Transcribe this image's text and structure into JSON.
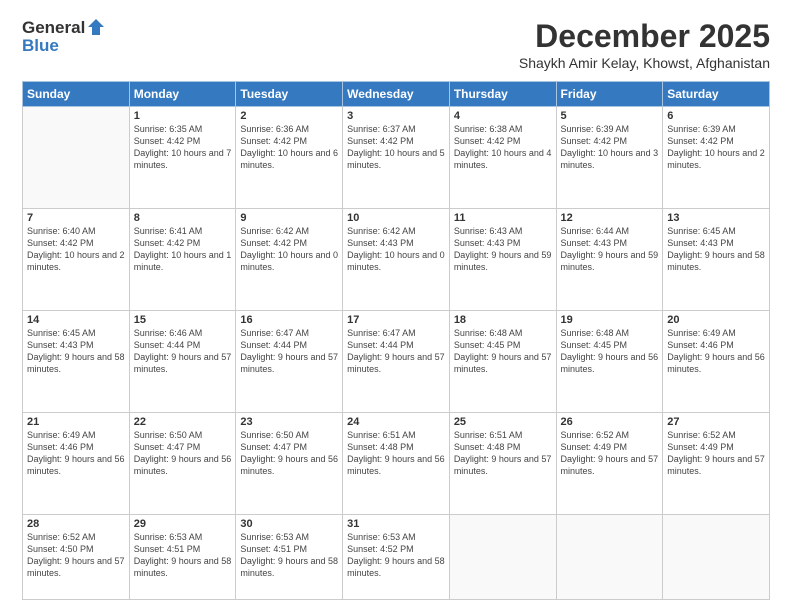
{
  "logo": {
    "line1": "General",
    "line2": "Blue"
  },
  "header": {
    "month": "December 2025",
    "location": "Shaykh Amir Kelay, Khowst, Afghanistan"
  },
  "weekdays": [
    "Sunday",
    "Monday",
    "Tuesday",
    "Wednesday",
    "Thursday",
    "Friday",
    "Saturday"
  ],
  "weeks": [
    [
      {
        "day": null
      },
      {
        "day": "1",
        "sunrise": "6:35 AM",
        "sunset": "4:42 PM",
        "daylight": "10 hours and 7 minutes."
      },
      {
        "day": "2",
        "sunrise": "6:36 AM",
        "sunset": "4:42 PM",
        "daylight": "10 hours and 6 minutes."
      },
      {
        "day": "3",
        "sunrise": "6:37 AM",
        "sunset": "4:42 PM",
        "daylight": "10 hours and 5 minutes."
      },
      {
        "day": "4",
        "sunrise": "6:38 AM",
        "sunset": "4:42 PM",
        "daylight": "10 hours and 4 minutes."
      },
      {
        "day": "5",
        "sunrise": "6:39 AM",
        "sunset": "4:42 PM",
        "daylight": "10 hours and 3 minutes."
      },
      {
        "day": "6",
        "sunrise": "6:39 AM",
        "sunset": "4:42 PM",
        "daylight": "10 hours and 2 minutes."
      }
    ],
    [
      {
        "day": "7",
        "sunrise": "6:40 AM",
        "sunset": "4:42 PM",
        "daylight": "10 hours and 2 minutes."
      },
      {
        "day": "8",
        "sunrise": "6:41 AM",
        "sunset": "4:42 PM",
        "daylight": "10 hours and 1 minute."
      },
      {
        "day": "9",
        "sunrise": "6:42 AM",
        "sunset": "4:42 PM",
        "daylight": "10 hours and 0 minutes."
      },
      {
        "day": "10",
        "sunrise": "6:42 AM",
        "sunset": "4:43 PM",
        "daylight": "10 hours and 0 minutes."
      },
      {
        "day": "11",
        "sunrise": "6:43 AM",
        "sunset": "4:43 PM",
        "daylight": "9 hours and 59 minutes."
      },
      {
        "day": "12",
        "sunrise": "6:44 AM",
        "sunset": "4:43 PM",
        "daylight": "9 hours and 59 minutes."
      },
      {
        "day": "13",
        "sunrise": "6:45 AM",
        "sunset": "4:43 PM",
        "daylight": "9 hours and 58 minutes."
      }
    ],
    [
      {
        "day": "14",
        "sunrise": "6:45 AM",
        "sunset": "4:43 PM",
        "daylight": "9 hours and 58 minutes."
      },
      {
        "day": "15",
        "sunrise": "6:46 AM",
        "sunset": "4:44 PM",
        "daylight": "9 hours and 57 minutes."
      },
      {
        "day": "16",
        "sunrise": "6:47 AM",
        "sunset": "4:44 PM",
        "daylight": "9 hours and 57 minutes."
      },
      {
        "day": "17",
        "sunrise": "6:47 AM",
        "sunset": "4:44 PM",
        "daylight": "9 hours and 57 minutes."
      },
      {
        "day": "18",
        "sunrise": "6:48 AM",
        "sunset": "4:45 PM",
        "daylight": "9 hours and 57 minutes."
      },
      {
        "day": "19",
        "sunrise": "6:48 AM",
        "sunset": "4:45 PM",
        "daylight": "9 hours and 56 minutes."
      },
      {
        "day": "20",
        "sunrise": "6:49 AM",
        "sunset": "4:46 PM",
        "daylight": "9 hours and 56 minutes."
      }
    ],
    [
      {
        "day": "21",
        "sunrise": "6:49 AM",
        "sunset": "4:46 PM",
        "daylight": "9 hours and 56 minutes."
      },
      {
        "day": "22",
        "sunrise": "6:50 AM",
        "sunset": "4:47 PM",
        "daylight": "9 hours and 56 minutes."
      },
      {
        "day": "23",
        "sunrise": "6:50 AM",
        "sunset": "4:47 PM",
        "daylight": "9 hours and 56 minutes."
      },
      {
        "day": "24",
        "sunrise": "6:51 AM",
        "sunset": "4:48 PM",
        "daylight": "9 hours and 56 minutes."
      },
      {
        "day": "25",
        "sunrise": "6:51 AM",
        "sunset": "4:48 PM",
        "daylight": "9 hours and 57 minutes."
      },
      {
        "day": "26",
        "sunrise": "6:52 AM",
        "sunset": "4:49 PM",
        "daylight": "9 hours and 57 minutes."
      },
      {
        "day": "27",
        "sunrise": "6:52 AM",
        "sunset": "4:49 PM",
        "daylight": "9 hours and 57 minutes."
      }
    ],
    [
      {
        "day": "28",
        "sunrise": "6:52 AM",
        "sunset": "4:50 PM",
        "daylight": "9 hours and 57 minutes."
      },
      {
        "day": "29",
        "sunrise": "6:53 AM",
        "sunset": "4:51 PM",
        "daylight": "9 hours and 58 minutes."
      },
      {
        "day": "30",
        "sunrise": "6:53 AM",
        "sunset": "4:51 PM",
        "daylight": "9 hours and 58 minutes."
      },
      {
        "day": "31",
        "sunrise": "6:53 AM",
        "sunset": "4:52 PM",
        "daylight": "9 hours and 58 minutes."
      },
      {
        "day": null
      },
      {
        "day": null
      },
      {
        "day": null
      }
    ]
  ]
}
